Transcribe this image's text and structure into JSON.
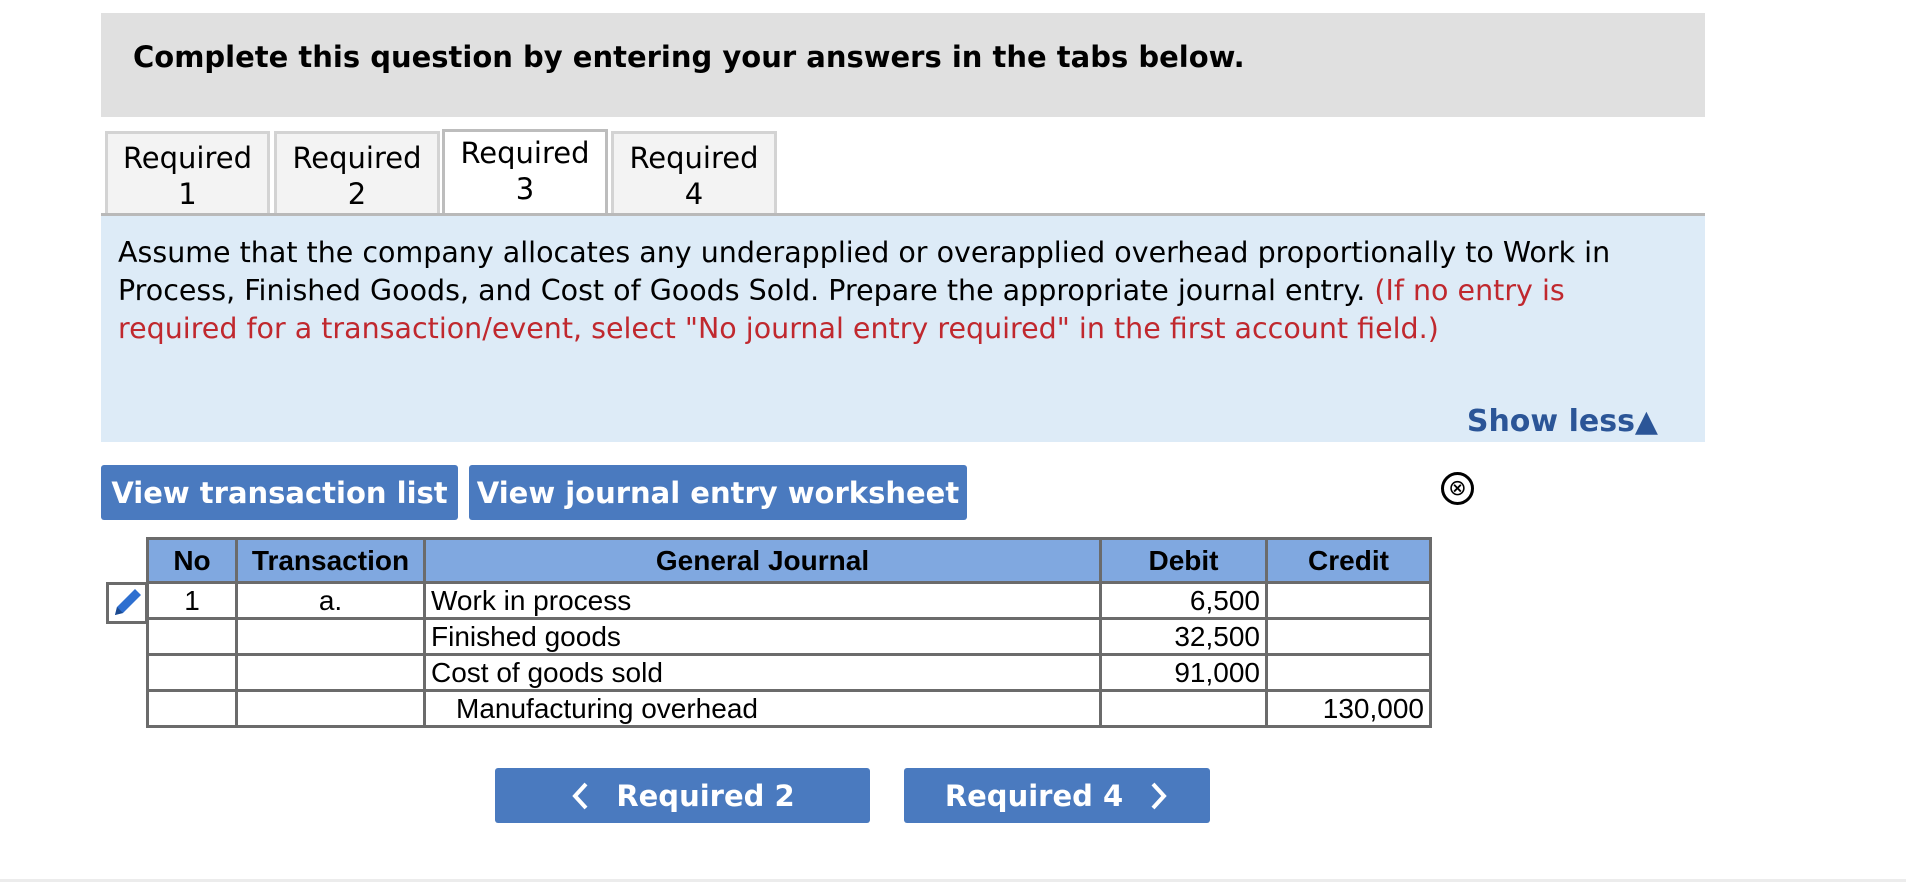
{
  "header": {
    "title": "Complete this question by entering your answers in the tabs below."
  },
  "tabs": [
    {
      "line1": "Required",
      "line2": "1"
    },
    {
      "line1": "Required",
      "line2": "2"
    },
    {
      "line1": "Required",
      "line2": "3"
    },
    {
      "line1": "Required",
      "line2": "4"
    }
  ],
  "active_tab_index": 2,
  "instructions": {
    "text": "Assume that the company allocates any underapplied or overapplied overhead proportionally to Work in Process, Finished Goods, and Cost of Goods Sold. Prepare the appropriate journal entry.",
    "note": "(If no entry is required for a transaction/event, select \"No journal entry required\" in the first account field.)",
    "toggle_label": "Show less▲"
  },
  "buttons": {
    "view_transactions": "View transaction list",
    "view_worksheet": "View journal entry worksheet",
    "close_icon": "⊗"
  },
  "journal": {
    "headers": {
      "no": "No",
      "transaction": "Transaction",
      "general_journal": "General Journal",
      "debit": "Debit",
      "credit": "Credit"
    },
    "rows": [
      {
        "no": "1",
        "transaction": "a.",
        "account": "Work in process",
        "debit": "6,500",
        "credit": ""
      },
      {
        "no": "",
        "transaction": "",
        "account": "Finished goods",
        "debit": "32,500",
        "credit": ""
      },
      {
        "no": "",
        "transaction": "",
        "account": "Cost of goods sold",
        "debit": "91,000",
        "credit": ""
      },
      {
        "no": "",
        "transaction": "",
        "account": "Manufacturing overhead",
        "debit": "",
        "credit": "130,000"
      }
    ]
  },
  "nav": {
    "prev_label": "Required 2",
    "next_label": "Required 4"
  },
  "colors": {
    "accent_blue": "#4a7abf",
    "header_blue": "#80a8e0",
    "info_bg": "#ddebf7",
    "note_red": "#c0282e"
  },
  "icons": {
    "edit": "pencil-icon",
    "close": "close-circle-icon",
    "prev": "chevron-left-icon",
    "next": "chevron-right-icon",
    "toggle": "triangle-up-icon"
  }
}
